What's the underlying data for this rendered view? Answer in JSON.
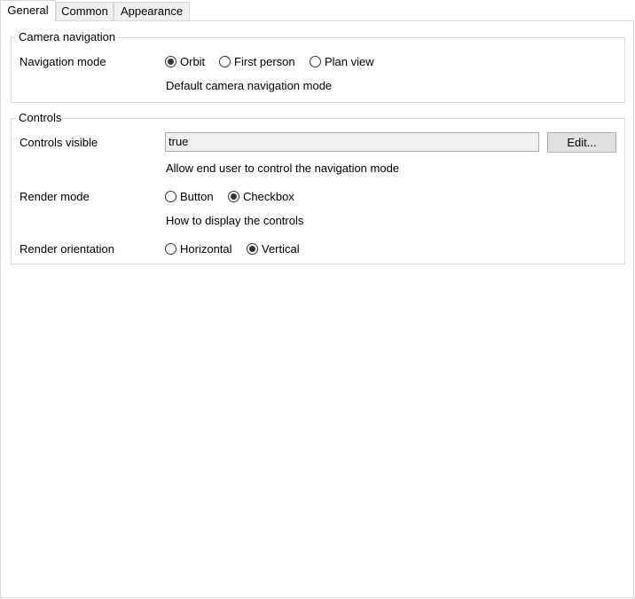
{
  "tabs": [
    {
      "label": "General",
      "active": true
    },
    {
      "label": "Common",
      "active": false
    },
    {
      "label": "Appearance",
      "active": false
    }
  ],
  "camera_navigation": {
    "legend": "Camera navigation",
    "navigation_mode": {
      "label": "Navigation mode",
      "options": [
        {
          "label": "Orbit",
          "checked": true
        },
        {
          "label": "First person",
          "checked": false
        },
        {
          "label": "Plan view",
          "checked": false
        }
      ],
      "description": "Default camera navigation mode"
    }
  },
  "controls": {
    "legend": "Controls",
    "controls_visible": {
      "label": "Controls visible",
      "value": "true",
      "edit_button": "Edit...",
      "description": "Allow end user to control the navigation mode"
    },
    "render_mode": {
      "label": "Render mode",
      "options": [
        {
          "label": "Button",
          "checked": false
        },
        {
          "label": "Checkbox",
          "checked": true
        }
      ],
      "description": "How to display the controls"
    },
    "render_orientation": {
      "label": "Render orientation",
      "options": [
        {
          "label": "Horizontal",
          "checked": false
        },
        {
          "label": "Vertical",
          "checked": true
        }
      ]
    }
  }
}
